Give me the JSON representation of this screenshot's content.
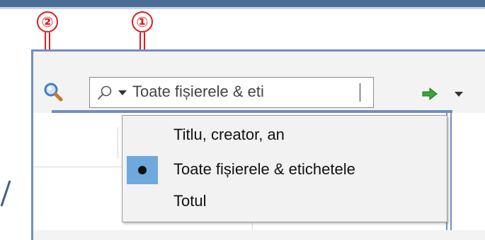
{
  "annotations": [
    {
      "id": "1",
      "glyph": "①"
    },
    {
      "id": "2",
      "glyph": "②"
    }
  ],
  "toolbar": {
    "search_icon": "magnifier-icon",
    "search": {
      "value": "Toate fișierele & eti",
      "mode_icon": "search-icon",
      "mode_dropdown_icon": "chevron-down-icon"
    },
    "go_icon": "green-arrow-icon",
    "go_dropdown_icon": "chevron-down-icon"
  },
  "search_mode_menu": {
    "items": [
      {
        "label": "Titlu, creator, an",
        "selected": false
      },
      {
        "label": "Toate fișierele & etichetele",
        "selected": true
      },
      {
        "label": "Totul",
        "selected": false
      }
    ]
  },
  "colors": {
    "annotation": "#e01b1b",
    "frame": "#6f8fbf",
    "selection": "#6fa8dc",
    "go_arrow": "#2e9e2e"
  }
}
